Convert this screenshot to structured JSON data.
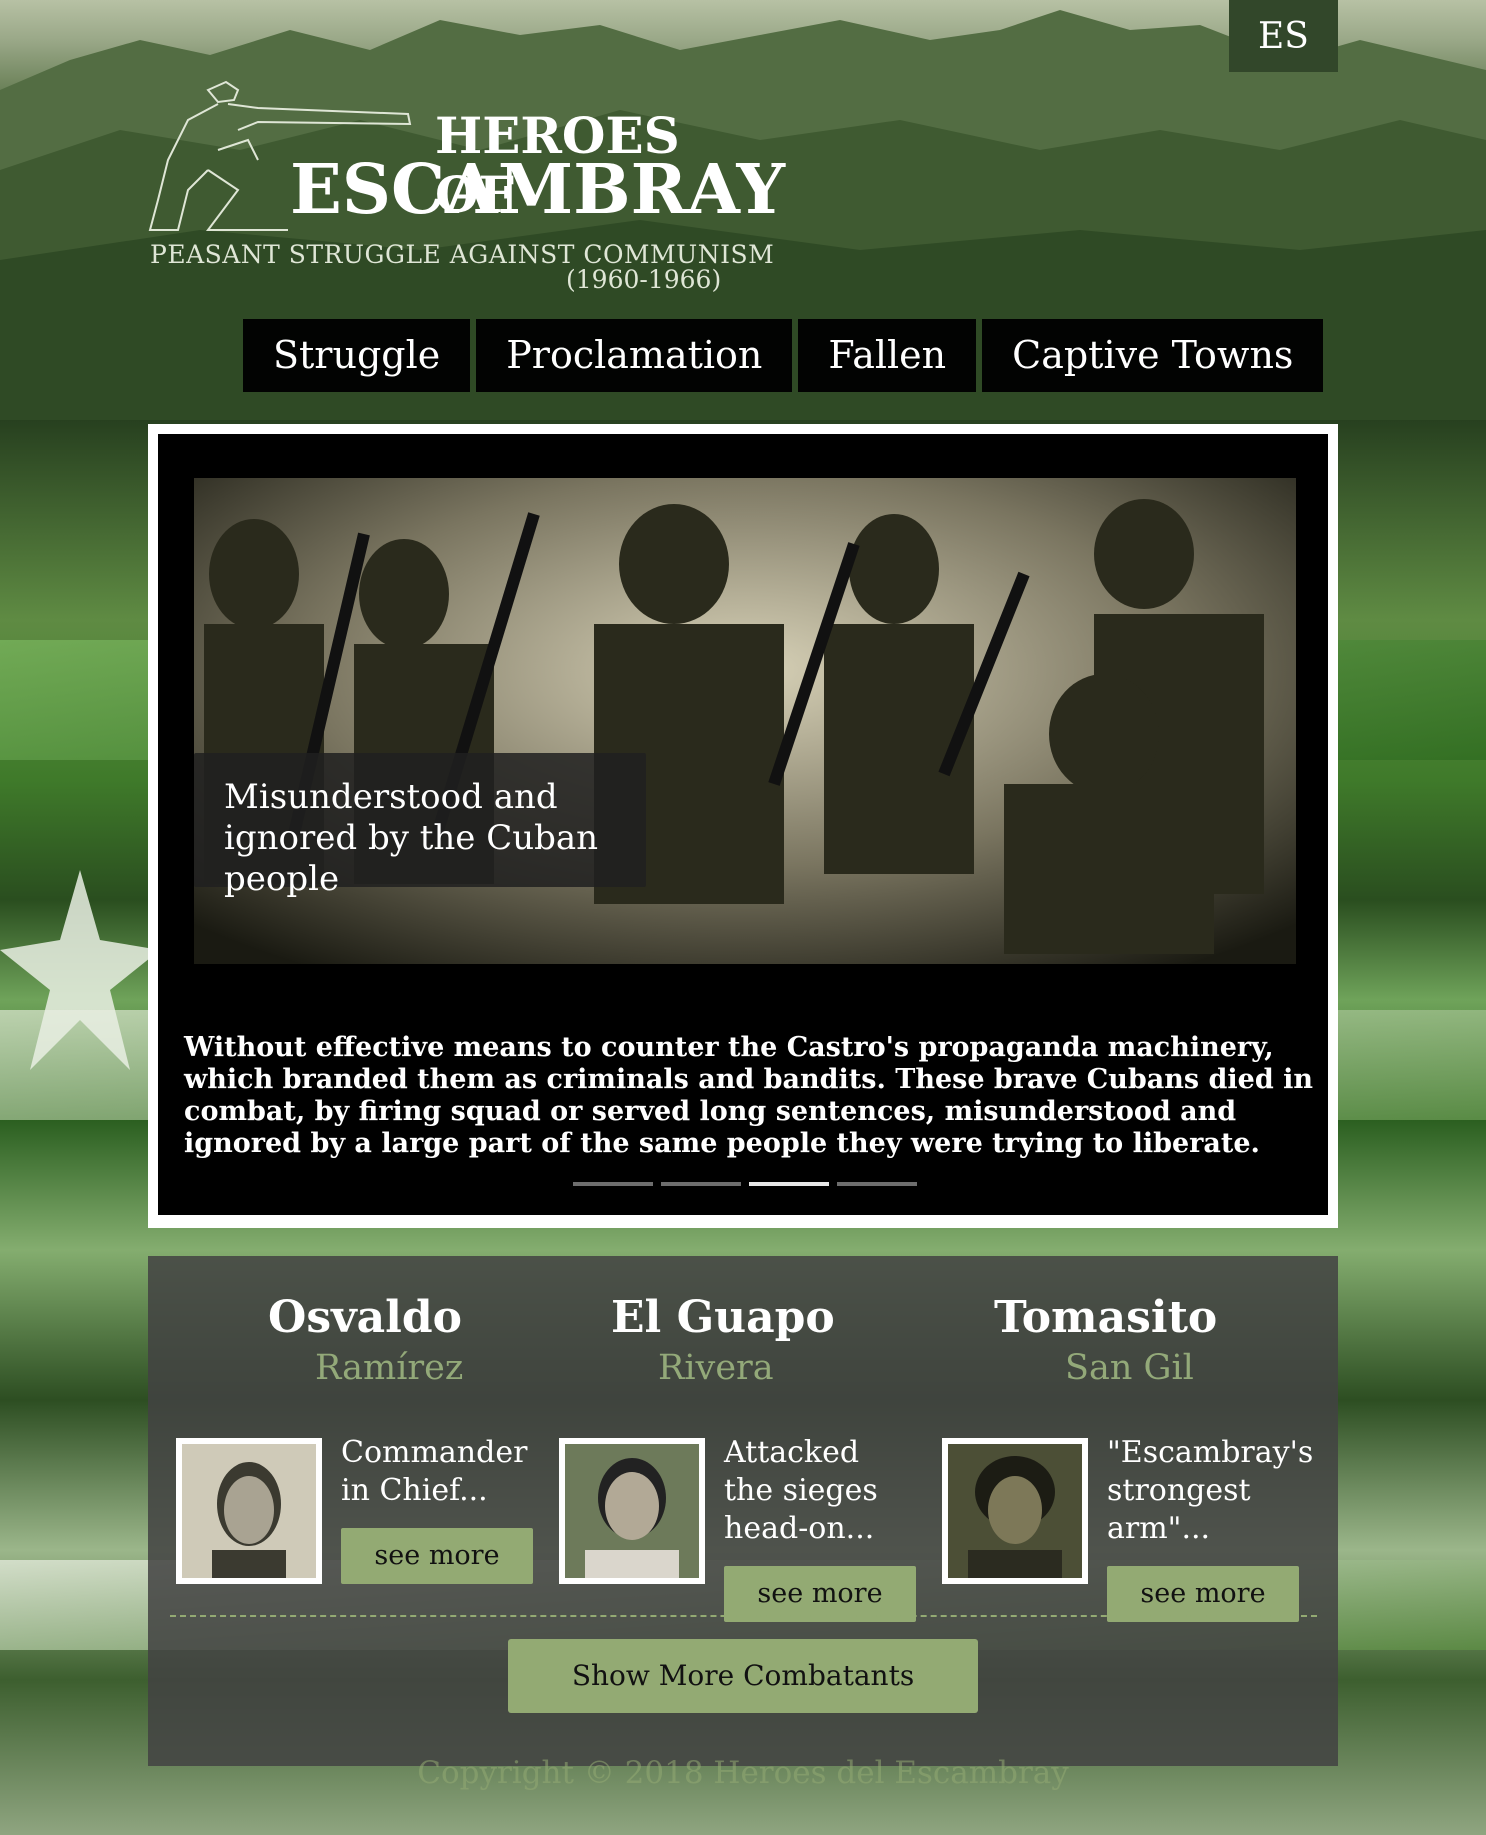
{
  "language_toggle": "ES",
  "logo": {
    "line1": "HEROES OF",
    "line2": "ESCAMBRAY",
    "subtitle": "PEASANT STRUGGLE AGAINST COMMUNISM",
    "years": "(1960-1966)"
  },
  "nav": {
    "items": [
      {
        "label": "Struggle"
      },
      {
        "label": "Proclamation"
      },
      {
        "label": "Fallen"
      },
      {
        "label": "Captive Towns"
      }
    ]
  },
  "slider": {
    "caption": "Misunderstood and ignored by the Cuban people",
    "text": "Without effective means to counter the Castro's propaganda machinery, which branded them as criminals and bandits. These brave Cubans died in combat, by firing squad or served long sentences, misunderstood and ignored by a large part of the same people they were trying to liberate.",
    "active_slide": 3,
    "slide_count": 4
  },
  "combatants": [
    {
      "first": "Osvaldo",
      "last": "Ramírez",
      "desc": "Commander in Chief...",
      "button": "see more"
    },
    {
      "first": "El Guapo",
      "last": "Rivera",
      "desc": "Attacked the sieges head-on...",
      "button": "see more"
    },
    {
      "first": "Tomasito",
      "last": "San Gil",
      "desc": "\"Escambray's strongest arm\"...",
      "button": "see more"
    }
  ],
  "show_more": "Show More Combatants",
  "footer": {
    "copyright": "Copyright © 2018 Heroes del Escambray"
  },
  "colors": {
    "accent": "#93aa73",
    "panel": "#424242",
    "nav_bg": "#020302"
  }
}
